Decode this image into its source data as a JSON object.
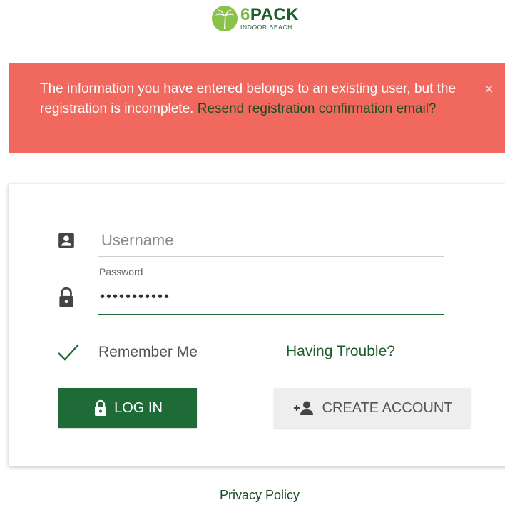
{
  "logo": {
    "title_number": "6",
    "title_word": "PACK",
    "subtitle": "INDOOR BEACH"
  },
  "alert": {
    "message": "The information you have entered belongs to an existing user, but the registration is incomplete. ",
    "link_text": "Resend registration confirmation email?",
    "close_symbol": "×",
    "background_color": "#f0685e"
  },
  "form": {
    "username": {
      "placeholder": "Username",
      "value": "",
      "icon": "account-box-icon"
    },
    "password": {
      "label": "Password",
      "value": "•••••••••••",
      "icon": "lock-icon"
    },
    "remember": {
      "label": "Remember Me",
      "checked": true
    },
    "trouble_link": "Having Trouble?",
    "login_button": "LOG IN",
    "create_button": "CREATE ACCOUNT"
  },
  "footer": {
    "privacy_link": "Privacy Policy"
  },
  "colors": {
    "brand_green": "#1e6b37",
    "logo_light_green": "#7cb342",
    "alert_red": "#f0685e"
  }
}
